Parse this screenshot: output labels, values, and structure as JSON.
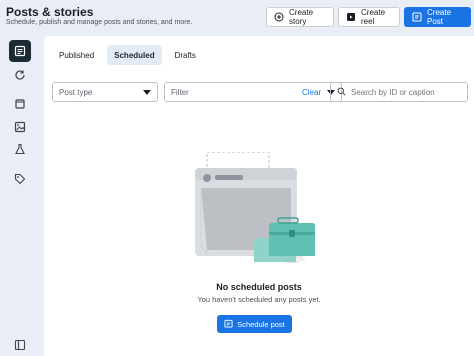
{
  "header": {
    "title": "Posts & stories",
    "subtitle": "Schedule, publish and manage posts and stories, and more.",
    "create_story_label": "Create story",
    "create_reel_label": "Create reel",
    "create_post_label": "Create Post"
  },
  "sidebar": {
    "items": [
      {
        "icon": "posts-icon",
        "active": true
      },
      {
        "icon": "refresh-icon",
        "active": false
      },
      {
        "icon": "content-icon",
        "active": false
      },
      {
        "icon": "image-icon",
        "active": false
      },
      {
        "icon": "flask-icon",
        "active": false
      },
      {
        "icon": "tag-icon",
        "active": false
      },
      {
        "icon": "collapse-panel-icon",
        "active": false
      }
    ]
  },
  "tabs": [
    {
      "label": "Published",
      "active": false
    },
    {
      "label": "Scheduled",
      "active": true
    },
    {
      "label": "Drafts",
      "active": false
    }
  ],
  "filters": {
    "post_type_label": "Post type",
    "filter_label": "Filter",
    "clear_label": "Clear",
    "search_placeholder": "Search by ID or caption"
  },
  "empty_state": {
    "title": "No scheduled posts",
    "description": "You haven't scheduled any posts yet.",
    "button_label": "Schedule post"
  },
  "colors": {
    "accent": "#1b74e4",
    "background": "#e9eef6",
    "active_tab_bg": "#e3ebf7",
    "nav_active_bg": "#1c2b33"
  }
}
